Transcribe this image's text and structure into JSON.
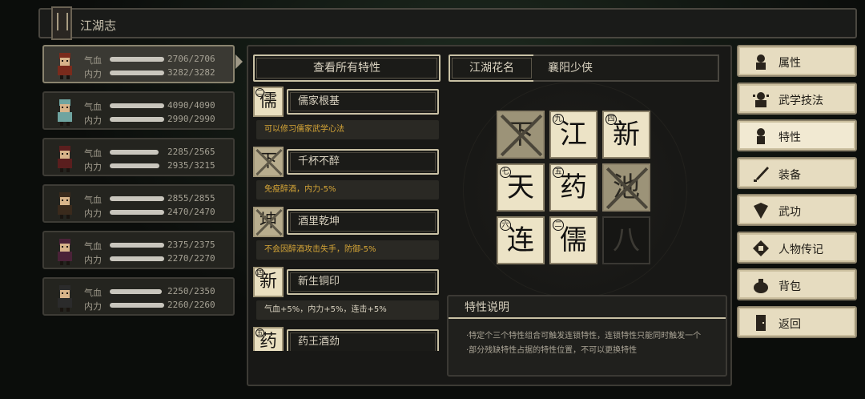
{
  "window": {
    "title": "江湖志"
  },
  "roster": [
    {
      "hp_label": "气血",
      "hp": "2706/2706",
      "hp_fill": 1.0,
      "mp_label": "内力",
      "mp": "3282/3282",
      "mp_fill": 1.0,
      "selected": true
    },
    {
      "hp_label": "气血",
      "hp": "4090/4090",
      "hp_fill": 1.0,
      "mp_label": "内力",
      "mp": "2990/2990",
      "mp_fill": 1.0
    },
    {
      "hp_label": "气血",
      "hp": "2285/2565",
      "hp_fill": 0.89,
      "mp_label": "内力",
      "mp": "2935/3215",
      "mp_fill": 0.91
    },
    {
      "hp_label": "气血",
      "hp": "2855/2855",
      "hp_fill": 1.0,
      "mp_label": "内力",
      "mp": "2470/2470",
      "mp_fill": 1.0
    },
    {
      "hp_label": "气血",
      "hp": "2375/2375",
      "hp_fill": 1.0,
      "mp_label": "内力",
      "mp": "2270/2270",
      "mp_fill": 1.0
    },
    {
      "hp_label": "气血",
      "hp": "2250/2350",
      "hp_fill": 0.96,
      "mp_label": "内力",
      "mp": "2260/2260",
      "mp_fill": 1.0
    }
  ],
  "traits_panel": {
    "view_all": "查看所有特性",
    "nickname_label": "江湖花名",
    "nickname_value": "襄阳少侠",
    "traits": [
      {
        "glyph": "儒",
        "num": "二",
        "name": "儒家根基",
        "desc": "可以修习儒家武学心法",
        "locked": false,
        "desc_color": "gold"
      },
      {
        "glyph": "下",
        "num": "",
        "name": "千杯不醉",
        "desc": "免疫醉酒，内力-5%",
        "locked": true,
        "desc_color": "gold"
      },
      {
        "glyph": "坤",
        "num": "",
        "name": "酒里乾坤",
        "desc": "不会因醉酒攻击失手，防御-5%",
        "locked": true,
        "desc_color": "gold"
      },
      {
        "glyph": "新",
        "num": "四",
        "name": "新生铜印",
        "desc": "气血+5%，内力+5%，连击+5%",
        "locked": false,
        "desc_color": "white"
      },
      {
        "glyph": "药",
        "num": "五",
        "name": "药王酒劲",
        "desc": "",
        "locked": false,
        "desc_color": "gold"
      }
    ]
  },
  "grid": [
    {
      "glyph": "下",
      "num": "",
      "state": "locked"
    },
    {
      "glyph": "江",
      "num": "九",
      "state": "normal"
    },
    {
      "glyph": "新",
      "num": "四",
      "state": "normal"
    },
    {
      "glyph": "天",
      "num": "七",
      "state": "normal"
    },
    {
      "glyph": "药",
      "num": "五",
      "state": "normal"
    },
    {
      "glyph": "池",
      "num": "",
      "state": "locked"
    },
    {
      "glyph": "连",
      "num": "六",
      "state": "normal"
    },
    {
      "glyph": "儒",
      "num": "二",
      "state": "normal"
    },
    {
      "glyph": "八",
      "num": "",
      "state": "empty"
    }
  ],
  "description": {
    "title": "特性说明",
    "lines": [
      "·特定个三个特性组合可触发连锁特性，连锁特性只能同时触发一个",
      "·部分残缺特性占据的特性位置，不可以更换特性"
    ]
  },
  "nav": [
    {
      "label": "属性",
      "icon": "attributes-icon"
    },
    {
      "label": "武学技法",
      "icon": "martial-skills-icon"
    },
    {
      "label": "特性",
      "icon": "traits-icon",
      "active": true
    },
    {
      "label": "装备",
      "icon": "sword-icon"
    },
    {
      "label": "武功",
      "icon": "scroll-book-icon"
    },
    {
      "label": "人物传记",
      "icon": "biography-icon"
    },
    {
      "label": "背包",
      "icon": "bag-icon"
    },
    {
      "label": "返回",
      "icon": "door-icon"
    }
  ],
  "colors": {
    "accent_gold": "#d6a637",
    "parchment": "#ece3c6",
    "frame": "#c9c1a5"
  }
}
